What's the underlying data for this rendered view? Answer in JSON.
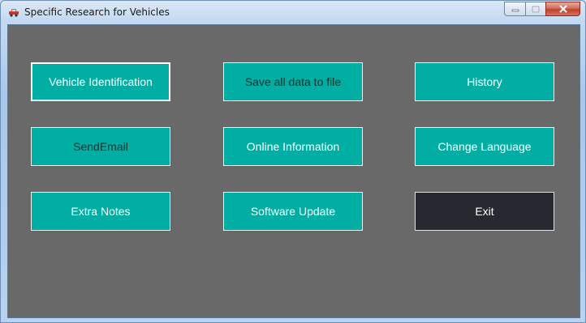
{
  "window": {
    "title": "Specific Research for Vehicles",
    "icon": "car-icon"
  },
  "buttons": {
    "vehicle_identification": "Vehicle Identification",
    "save_all_data": "Save all data to file",
    "history": "History",
    "send_email": "SendEmail",
    "online_information": "Online Information",
    "change_language": "Change Language",
    "extra_notes": "Extra Notes",
    "software_update": "Software Update",
    "exit": "Exit"
  },
  "colors": {
    "accent": "#00aea3",
    "client_background": "#696969",
    "exit_background": "#262a30"
  }
}
